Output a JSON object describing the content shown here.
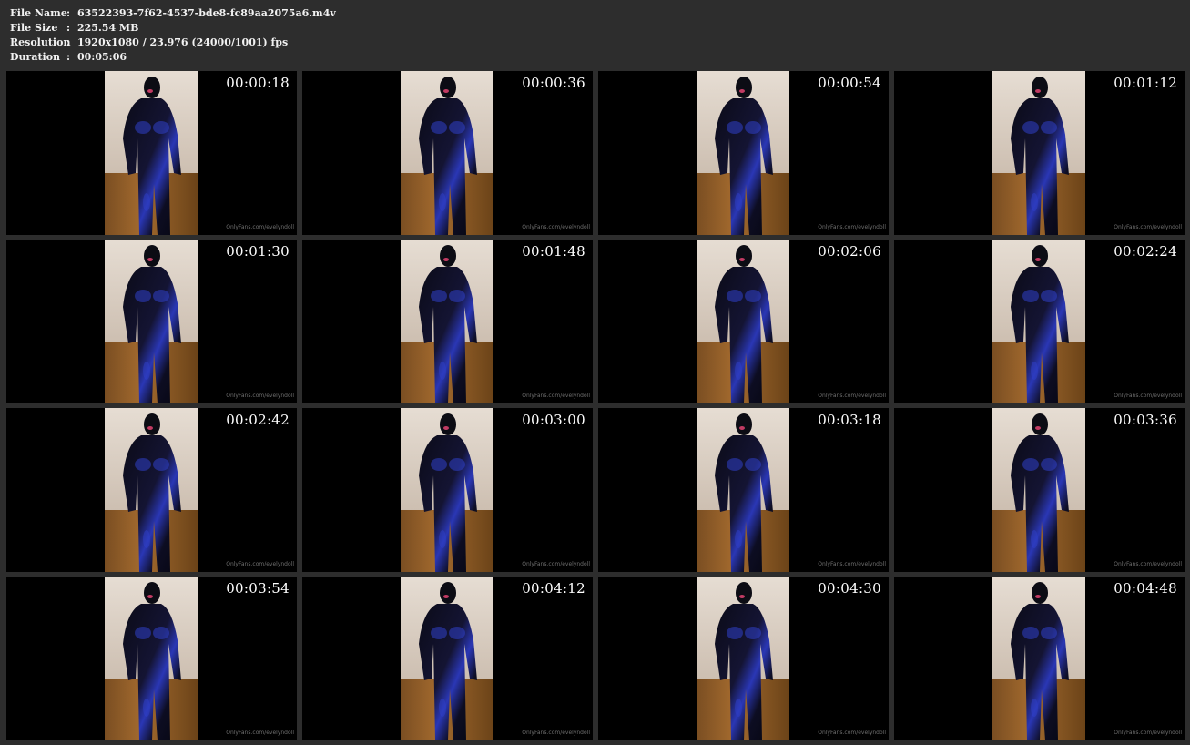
{
  "info": {
    "file_name_label": "File Name",
    "file_name": "63522393-7f62-4537-bde8-fc89aa2075a6.m4v",
    "file_size_label": "File Size",
    "file_size": "225.54 MB",
    "resolution_label": "Resolution",
    "resolution": "1920x1080 / 23.976 (24000/1001) fps",
    "duration_label": "Duration",
    "duration": "00:05:06",
    "separator": ":"
  },
  "thumbnails": [
    {
      "time": "00:00:18",
      "watermark": "OnlyFans.com/evelyndoll"
    },
    {
      "time": "00:00:36",
      "watermark": "OnlyFans.com/evelyndoll"
    },
    {
      "time": "00:00:54",
      "watermark": "OnlyFans.com/evelyndoll"
    },
    {
      "time": "00:01:12",
      "watermark": "OnlyFans.com/evelyndoll"
    },
    {
      "time": "00:01:30",
      "watermark": "OnlyFans.com/evelyndoll"
    },
    {
      "time": "00:01:48",
      "watermark": "OnlyFans.com/evelyndoll"
    },
    {
      "time": "00:02:06",
      "watermark": "OnlyFans.com/evelyndoll"
    },
    {
      "time": "00:02:24",
      "watermark": "OnlyFans.com/evelyndoll"
    },
    {
      "time": "00:02:42",
      "watermark": "OnlyFans.com/evelyndoll"
    },
    {
      "time": "00:03:00",
      "watermark": "OnlyFans.com/evelyndoll"
    },
    {
      "time": "00:03:18",
      "watermark": "OnlyFans.com/evelyndoll"
    },
    {
      "time": "00:03:36",
      "watermark": "OnlyFans.com/evelyndoll"
    },
    {
      "time": "00:03:54",
      "watermark": "OnlyFans.com/evelyndoll"
    },
    {
      "time": "00:04:12",
      "watermark": "OnlyFans.com/evelyndoll"
    },
    {
      "time": "00:04:30",
      "watermark": "OnlyFans.com/evelyndoll"
    },
    {
      "time": "00:04:48",
      "watermark": "OnlyFans.com/evelyndoll"
    }
  ]
}
